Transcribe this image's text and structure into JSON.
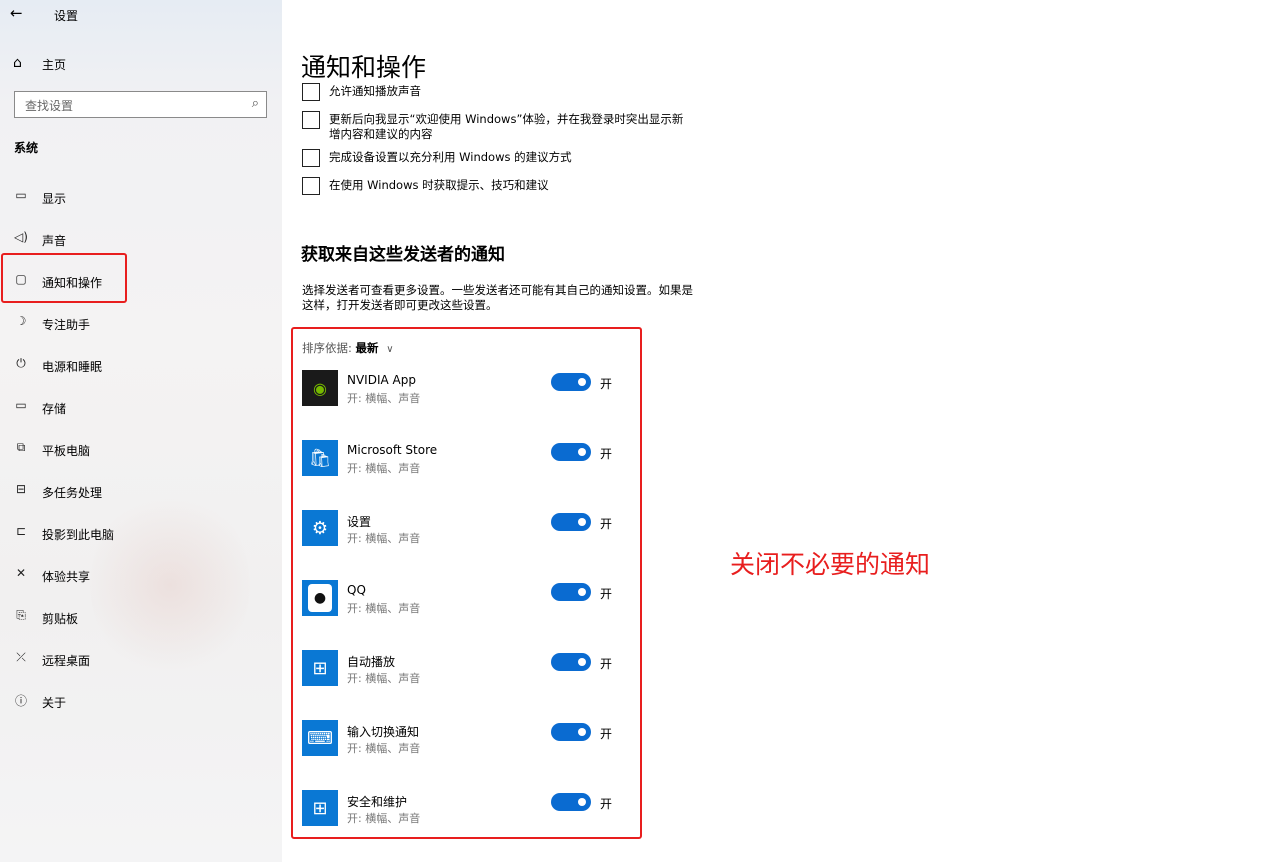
{
  "window": {
    "title": "设置",
    "back_icon": "←"
  },
  "sidebar": {
    "home_label": "主页",
    "search_placeholder": "查找设置",
    "section": "系统",
    "items": [
      {
        "label": "显示",
        "icon": "display-icon"
      },
      {
        "label": "声音",
        "icon": "speaker-icon"
      },
      {
        "label": "通知和操作",
        "icon": "notification-icon",
        "active": true
      },
      {
        "label": "专注助手",
        "icon": "moon-icon"
      },
      {
        "label": "电源和睡眠",
        "icon": "power-icon"
      },
      {
        "label": "存储",
        "icon": "storage-icon"
      },
      {
        "label": "平板电脑",
        "icon": "tablet-icon"
      },
      {
        "label": "多任务处理",
        "icon": "multitask-icon"
      },
      {
        "label": "投影到此电脑",
        "icon": "project-icon"
      },
      {
        "label": "体验共享",
        "icon": "share-icon"
      },
      {
        "label": "剪贴板",
        "icon": "clipboard-icon"
      },
      {
        "label": "远程桌面",
        "icon": "remote-desktop-icon"
      },
      {
        "label": "关于",
        "icon": "info-icon"
      }
    ]
  },
  "main": {
    "title": "通知和操作",
    "checkboxes": [
      {
        "label": "允许通知播放声音",
        "checked": false
      },
      {
        "label": "更新后向我显示“欢迎使用 Windows”体验，并在我登录时突出显示新增内容和建议的内容",
        "checked": false
      },
      {
        "label": "完成设备设置以充分利用 Windows 的建议方式",
        "checked": false
      },
      {
        "label": "在使用 Windows 时获取提示、技巧和建议",
        "checked": false
      }
    ],
    "senders_title": "获取来自这些发送者的通知",
    "senders_desc": "选择发送者可查看更多设置。一些发送者还可能有其自己的通知设置。如果是这样，打开发送者即可更改这些设置。",
    "sort_label": "排序依据:",
    "sort_value": "最新",
    "senders": [
      {
        "name": "NVIDIA App",
        "sub": "开: 横幅、声音",
        "toggle": "开",
        "on": true,
        "icon": "nvidia-icon"
      },
      {
        "name": "Microsoft Store",
        "sub": "开: 横幅、声音",
        "toggle": "开",
        "on": true,
        "icon": "store-icon"
      },
      {
        "name": "设置",
        "sub": "开: 横幅、声音",
        "toggle": "开",
        "on": true,
        "icon": "gear-icon"
      },
      {
        "name": "QQ",
        "sub": "开: 横幅、声音",
        "toggle": "开",
        "on": true,
        "icon": "qq-icon"
      },
      {
        "name": "自动播放",
        "sub": "开: 横幅、声音",
        "toggle": "开",
        "on": true,
        "icon": "autoplay-icon"
      },
      {
        "name": "输入切换通知",
        "sub": "开: 横幅、声音",
        "toggle": "开",
        "on": true,
        "icon": "keyboard-icon"
      },
      {
        "name": "安全和维护",
        "sub": "开: 横幅、声音",
        "toggle": "开",
        "on": true,
        "icon": "security-icon"
      }
    ]
  },
  "annotation": "关闭不必要的通知",
  "colors": {
    "accent": "#0a6bd1",
    "highlight": "#e81e1e"
  }
}
